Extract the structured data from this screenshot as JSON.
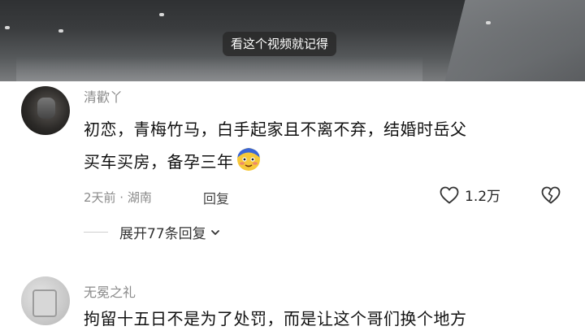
{
  "video": {
    "subtitle": "看这个视频就记得"
  },
  "comments": [
    {
      "username": "清歡丫",
      "text_line1": "初恋，青梅竹马，白手起家且不离不弃，结婚时岳父",
      "text_line2": "买车买房，备孕三年",
      "emoji": "blushing-face-emoji",
      "time_location": "2天前 · 湖南",
      "reply_label": "回复",
      "like_count": "1.2万",
      "expand_label": "展开77条回复"
    },
    {
      "username": "无冕之礼",
      "text_line1": "拘留十五日不是为了处罚，而是让这个哥们换个地方"
    }
  ],
  "icons": {
    "like": "heart-outline-icon",
    "dislike": "broken-heart-icon",
    "expand": "chevron-down-icon"
  }
}
